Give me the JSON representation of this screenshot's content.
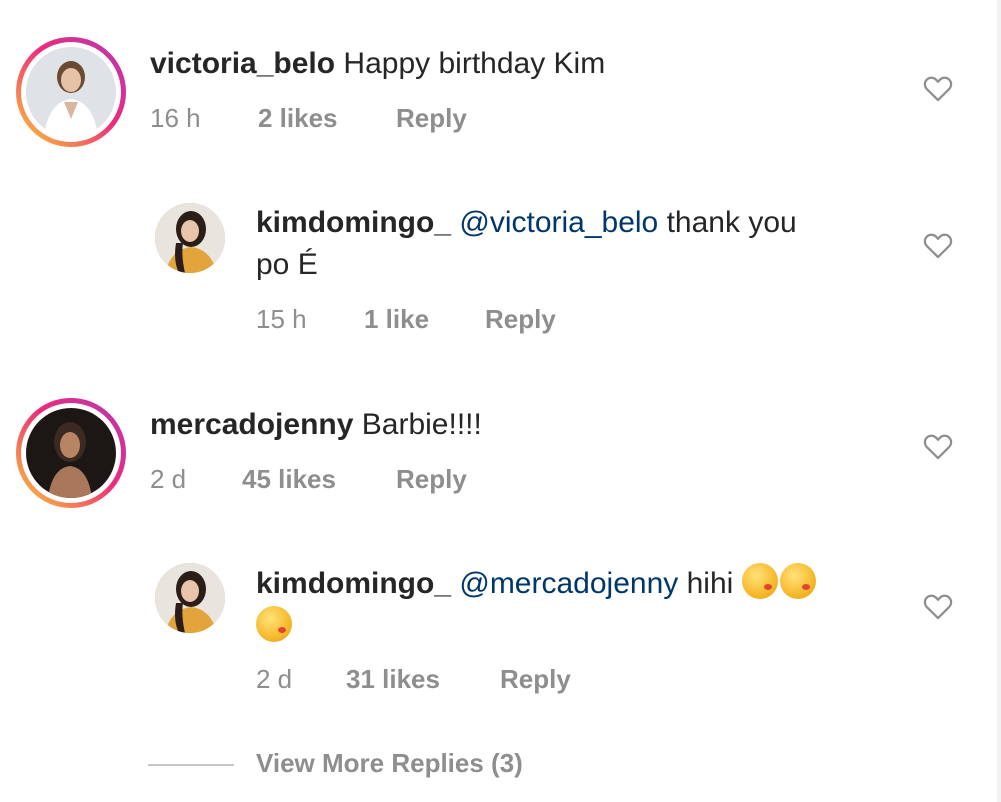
{
  "comments": [
    {
      "username": "victoria_belo",
      "text": "Happy birthday Kim",
      "time": "16 h",
      "likes": "2 likes",
      "reply": "Reply"
    },
    {
      "username": "kimdomingo_",
      "mention": "@victoria_belo",
      "text_line1": "thank you",
      "text_line2": "po É",
      "time": "15 h",
      "likes": "1 like",
      "reply": "Reply"
    },
    {
      "username": "mercadojenny",
      "text": "Barbie!!!!",
      "time": "2 d",
      "likes": "45 likes",
      "reply": "Reply"
    },
    {
      "username": "kimdomingo_",
      "mention": "@mercadojenny",
      "text": "hihi",
      "emoji_count": 3,
      "emoji_name": "kissing-face-emoji",
      "time": "2 d",
      "likes": "31 likes",
      "reply": "Reply"
    }
  ],
  "view_more": "View More Replies (3)",
  "icons": {
    "like": "heart-icon"
  },
  "colors": {
    "mention": "#00376b",
    "meta": "#8e8e8e",
    "story_ring_start": "#f9ce34",
    "story_ring_end": "#b33bb5"
  }
}
